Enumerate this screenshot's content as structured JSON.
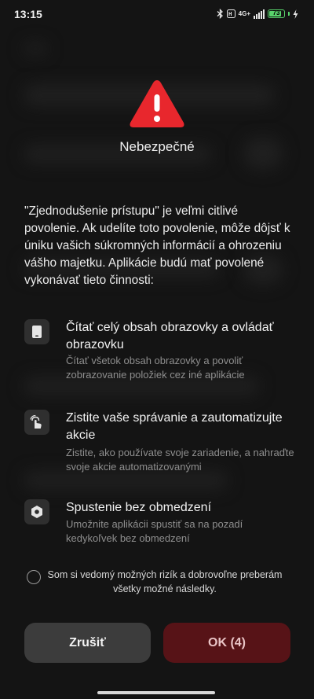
{
  "status_bar": {
    "time": "13:15",
    "network": "4G+",
    "battery": "73",
    "battery_level": 0.73,
    "icons": [
      "bluetooth-icon",
      "hd-volte-icon",
      "signal-icon",
      "battery-icon",
      "charging-icon"
    ]
  },
  "dialog": {
    "icon": "warning-icon",
    "title": "Nebezpečné",
    "description": "\"Zjednodušenie prístupu\" je veľmi citlivé povolenie. Ak udelíte toto povolenie, môže dôjsť k úniku vašich súkromných informácií a ohrozeniu vášho majetku. Aplikácie budú mať povolené vykonávať tieto činnosti:",
    "permissions": [
      {
        "icon": "phone-screen-icon",
        "title": "Čítať celý obsah obrazovky a ovládať obrazovku",
        "desc": "Čítať všetok obsah obrazovky a povoliť zobrazovanie položiek cez iné aplikácie"
      },
      {
        "icon": "touch-gesture-icon",
        "title": "Zistite vaše správanie a zautomatizujte akcie",
        "desc": "Zistite, ako používate svoje zariadenie, a nahraďte svoje akcie automatizovanými"
      },
      {
        "icon": "hexagon-settings-icon",
        "title": "Spustenie bez obmedzení",
        "desc": "Umožnite aplikácii spustiť sa na pozadí kedykoľvek bez obmedzení"
      }
    ],
    "consent": "Som si vedomý možných rizík a dobrovoľne preberám všetky možné následky.",
    "cancel_label": "Zrušiť",
    "ok_label": "OK (4)"
  },
  "colors": {
    "warning_red": "#e8272d",
    "ok_button_bg": "#571317",
    "cancel_button_bg": "#3c3c3c",
    "battery_green": "#58d26b"
  }
}
